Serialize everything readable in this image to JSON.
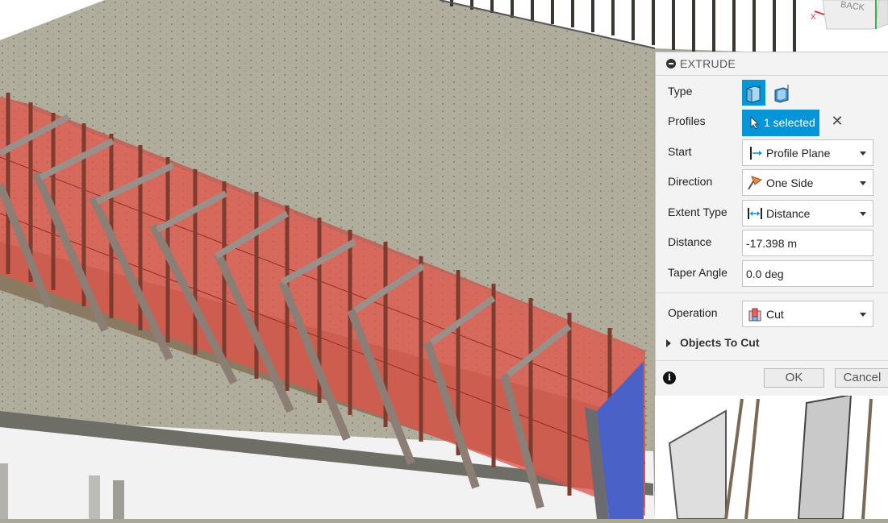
{
  "panel": {
    "title": "EXTRUDE",
    "type": {
      "label": "Type",
      "options": [
        "solid-extrude-icon",
        "thin-extrude-icon"
      ],
      "selected": 0
    },
    "profiles": {
      "label": "Profiles",
      "value": "1 selected"
    },
    "start": {
      "label": "Start",
      "value": "Profile Plane",
      "icon": "profile-plane-icon"
    },
    "direction": {
      "label": "Direction",
      "value": "One Side",
      "icon": "one-side-icon"
    },
    "extent_type": {
      "label": "Extent Type",
      "value": "Distance",
      "icon": "distance-icon"
    },
    "distance": {
      "label": "Distance",
      "value": "-17.398 m"
    },
    "taper_angle": {
      "label": "Taper Angle",
      "value": "0.0 deg"
    },
    "operation": {
      "label": "Operation",
      "value": "Cut",
      "icon": "cut-icon"
    },
    "objects_to_cut": {
      "label": "Objects To Cut"
    },
    "ok_label": "OK",
    "cancel_label": "Cancel"
  },
  "viewcube": {
    "face_label": "BACK"
  },
  "colors": {
    "accent": "#0696d7",
    "cut_body": "#e0554a",
    "cut_face": "#4a62c8",
    "ground": "#a9a796"
  }
}
